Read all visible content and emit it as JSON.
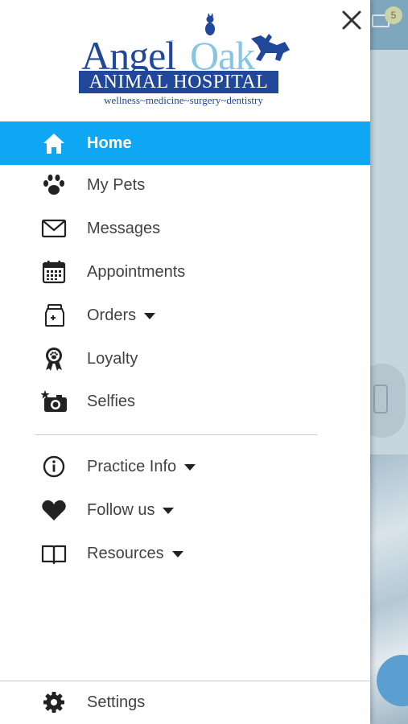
{
  "background_app": {
    "badge_count": "5"
  },
  "logo": {
    "word1": "Angel",
    "word2": "Oak",
    "banner": "ANIMAL HOSPITAL",
    "tagline": "wellness~medicine~surgery~dentistry"
  },
  "menu": {
    "primary": [
      {
        "label": "Home",
        "icon": "home-icon",
        "active": true
      },
      {
        "label": "My Pets",
        "icon": "paw-icon"
      },
      {
        "label": "Messages",
        "icon": "envelope-icon"
      },
      {
        "label": "Appointments",
        "icon": "calendar-icon"
      },
      {
        "label": "Orders",
        "icon": "medicine-jar-icon",
        "has_dropdown": true
      },
      {
        "label": "Loyalty",
        "icon": "award-ribbon-icon"
      },
      {
        "label": "Selfies",
        "icon": "camera-star-icon"
      }
    ],
    "secondary": [
      {
        "label": "Practice Info",
        "icon": "info-icon",
        "has_dropdown": true
      },
      {
        "label": "Follow us",
        "icon": "heart-icon",
        "has_dropdown": true
      },
      {
        "label": "Resources",
        "icon": "book-icon",
        "has_dropdown": true
      }
    ],
    "footer": {
      "label": "Settings",
      "icon": "gear-icon"
    }
  },
  "colors": {
    "active_bg": "#0fa7f3",
    "brand_blue": "#21479a",
    "brand_light_blue": "#86c5e4",
    "text": "#424242"
  }
}
